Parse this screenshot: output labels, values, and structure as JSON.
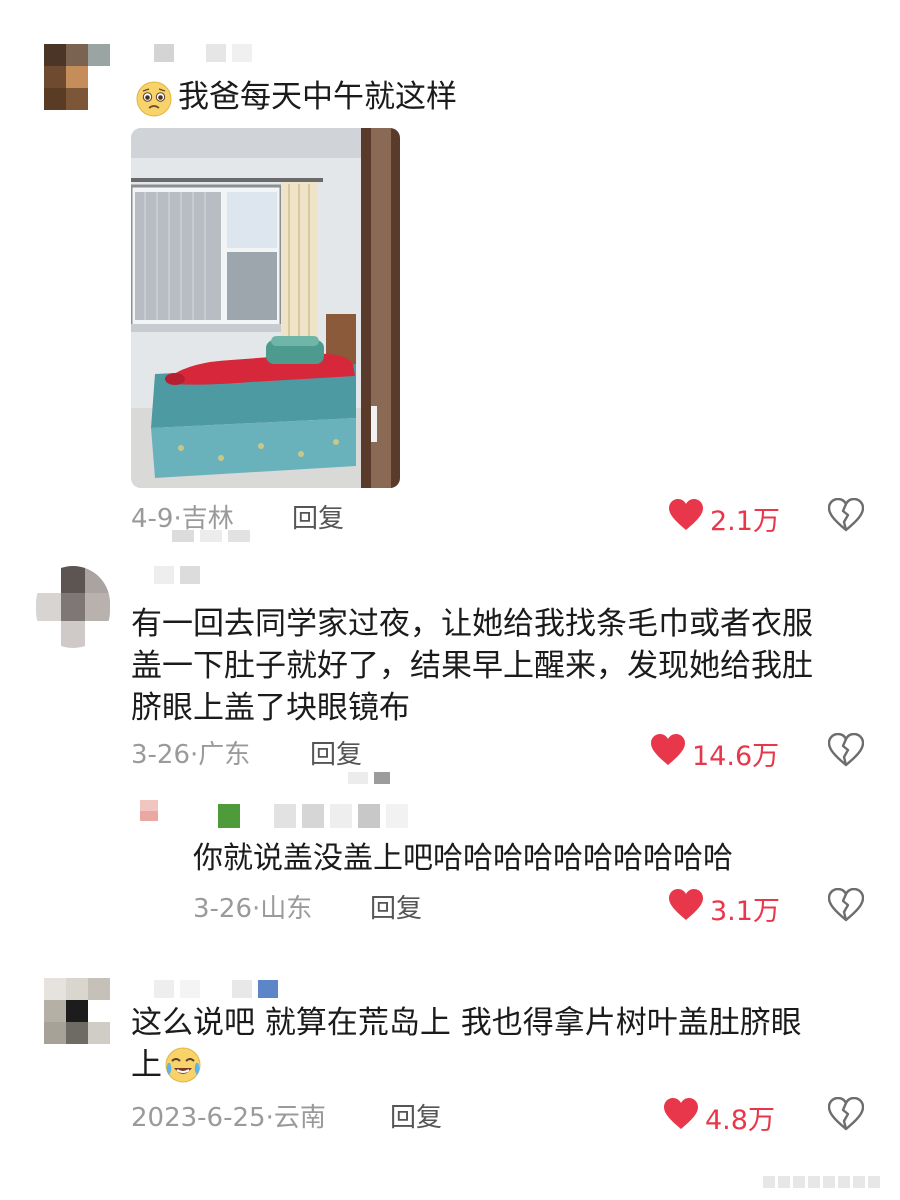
{
  "colors": {
    "like": "#e8374a",
    "meta": "#9a9a9a",
    "text": "#1b1b1b"
  },
  "comments": [
    {
      "text_lines": [
        "我爸每天中午就这样"
      ],
      "has_emoji": true,
      "emoji": "pleading-face-emoji",
      "has_image": true,
      "image": "bedroom-photo",
      "date": "4-9",
      "location": "吉林",
      "reply_label": "回复",
      "likes": "2.1万"
    },
    {
      "text_lines": [
        "有一回去同学家过夜，让她给我找条毛巾或者衣服",
        "盖一下肚子就好了，结果早上醒来，发现她给我肚",
        "脐眼上盖了块眼镜布"
      ],
      "date": "3-26",
      "location": "广东",
      "reply_label": "回复",
      "likes": "14.6万"
    },
    {
      "is_reply": true,
      "text_lines": [
        "你就说盖没盖上吧哈哈哈哈哈哈哈哈哈哈"
      ],
      "date": "3-26",
      "location": "山东",
      "reply_label": "回复",
      "likes": "3.1万"
    },
    {
      "text_lines": [
        "这么说吧 就算在荒岛上 我也得拿片树叶盖肚脐眼",
        "上"
      ],
      "has_emoji": true,
      "emoji": "crying-laughing-emoji",
      "date": "2023-6-25",
      "location": "云南",
      "reply_label": "回复",
      "likes": "4.8万"
    }
  ],
  "meta_separator": "·"
}
